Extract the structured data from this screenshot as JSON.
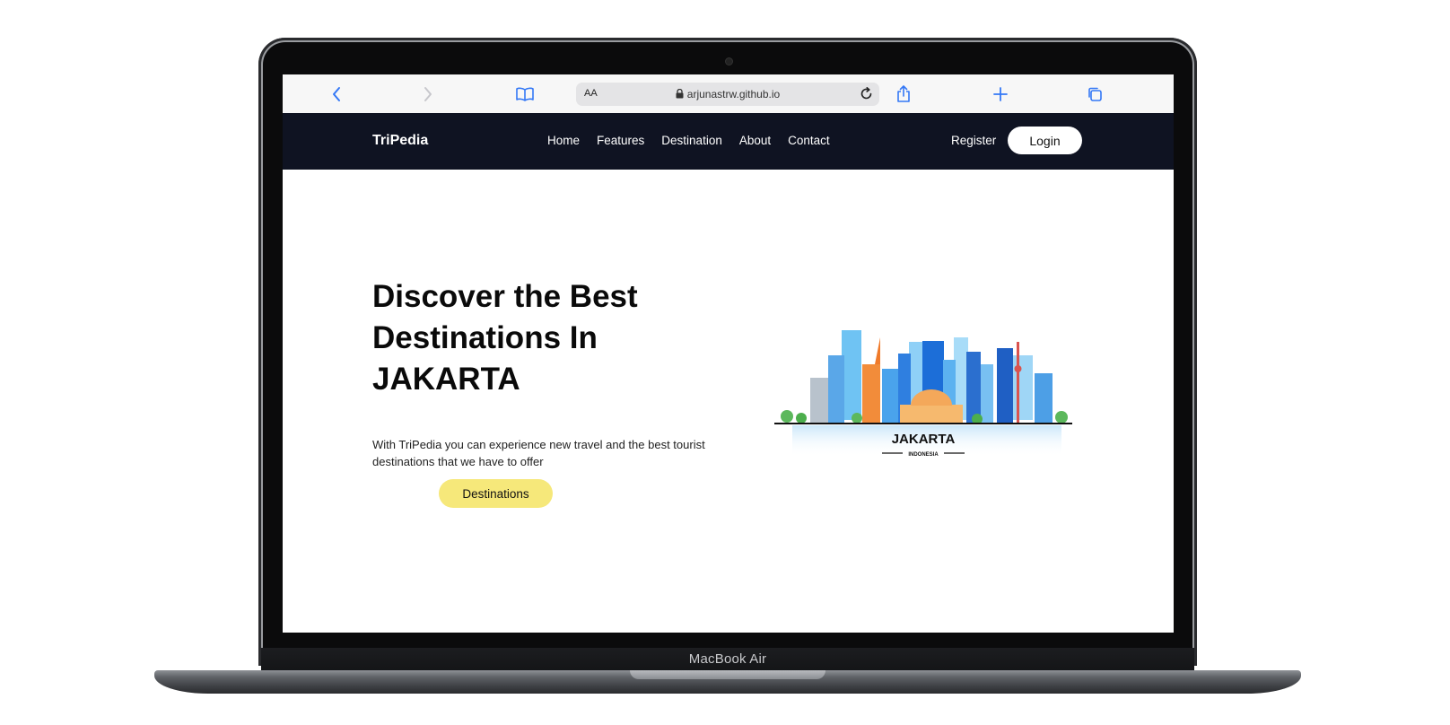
{
  "device": {
    "label": "MacBook Air"
  },
  "browser": {
    "address_prefix": "AA",
    "url": "arjunastrw.github.io"
  },
  "site": {
    "brand": "TriPedia",
    "nav": [
      "Home",
      "Features",
      "Destination",
      "About",
      "Contact"
    ],
    "register_label": "Register",
    "login_label": "Login"
  },
  "hero": {
    "title_lines": [
      "Discover the Best",
      "Destinations In",
      "JAKARTA"
    ],
    "subtitle": "With TriPedia you can experience new travel and the best tourist destinations that we have to offer",
    "cta_label": "Destinations",
    "illustration": {
      "city": "JAKARTA",
      "country": "INDONESIA"
    }
  },
  "colors": {
    "navbar_bg": "#0f1322",
    "cta_bg": "#f6e87a",
    "browser_accent": "#3478f6"
  }
}
